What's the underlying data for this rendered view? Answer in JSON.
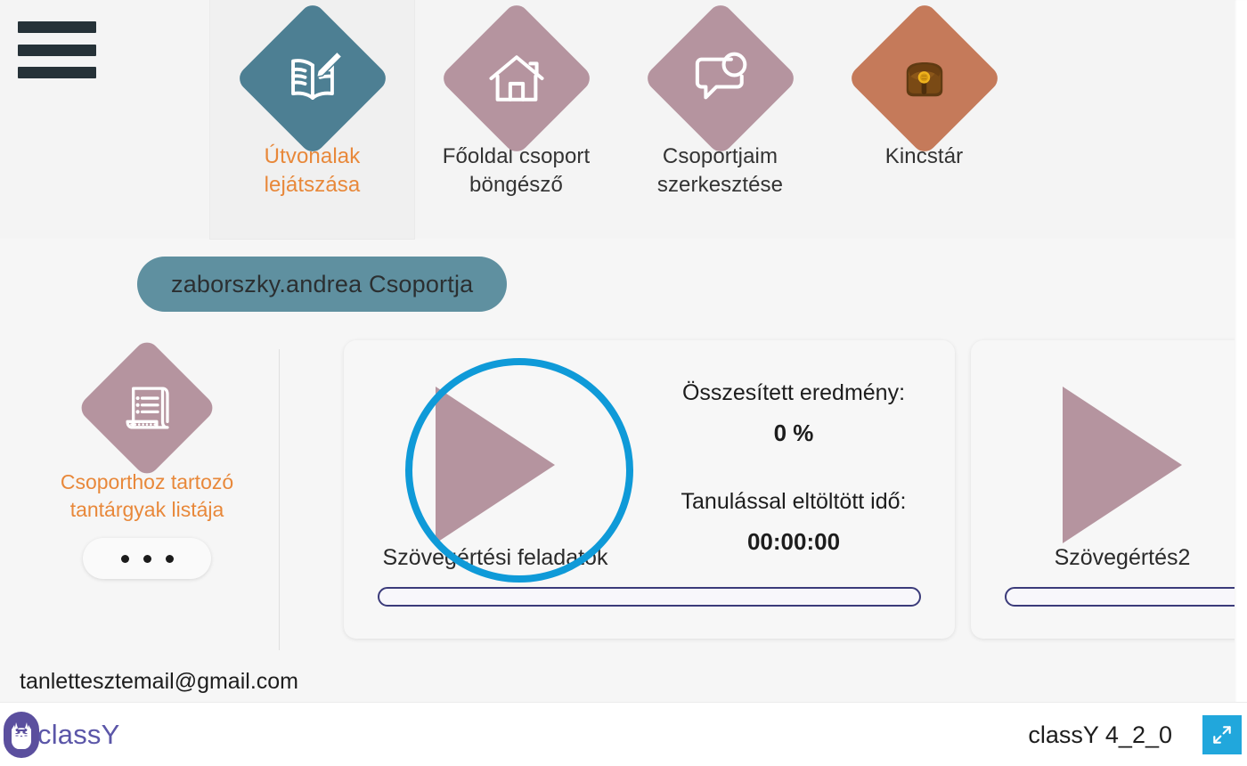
{
  "app": {
    "name": "classY",
    "version_label": "classY 4_2_0",
    "accent_orange": "#e8883a",
    "accent_teal": "#4d7f93",
    "accent_mauve": "#b5949f",
    "accent_terracotta": "#c57a5a",
    "highlight_blue": "#0f9ad8",
    "logo_purple": "#5b56a8"
  },
  "topnav": {
    "menu_icon": "hamburger-menu-icon",
    "items": [
      {
        "icon": "book-pencil-icon",
        "label": "Útvonalak\nlejátszása",
        "line1": "Útvonalak",
        "line2": "lejátszása",
        "active": true
      },
      {
        "icon": "home-icon",
        "label": "Főoldal csoport böngésző",
        "line1": "Főoldal csoport",
        "line2": "böngésző",
        "active": false
      },
      {
        "icon": "chat-bubble-icon",
        "label": "Csoportjaim szerkesztése",
        "line1": "Csoportjaim",
        "line2": "szerkesztése",
        "active": false
      },
      {
        "icon": "treasure-bag-icon",
        "label": "Kincstár",
        "line1": "Kincstár",
        "line2": "",
        "active": false
      }
    ]
  },
  "group": {
    "title": "zaborszky.andrea Csoportja"
  },
  "subject": {
    "icon": "list-document-icon",
    "label_line1": "Csoporthoz tartozó",
    "label_line2": "tantárgyak listája",
    "more_label": "•••"
  },
  "cards": [
    {
      "title": "Szövegértési feladatok",
      "play_icon": "play-icon",
      "result_label": "Összesített eredmény:",
      "result_value": "0 %",
      "time_label": "Tanulással eltöltött idő:",
      "time_value": "00:00:00",
      "progress_percent": 0
    },
    {
      "title": "Szövegértés2",
      "play_icon": "play-icon",
      "result_label": "",
      "result_value": "",
      "time_label": "",
      "time_value": "",
      "progress_percent": 0
    }
  ],
  "account": {
    "email": "tanlettesztemail@gmail.com"
  },
  "footer": {
    "logo_text": "classY",
    "logo_icon": "classy-cat-logo-icon",
    "version": "classY 4_2_0",
    "fullscreen_icon": "fullscreen-expand-icon"
  },
  "overlay": {
    "highlight_target": "play-button-first-card"
  }
}
